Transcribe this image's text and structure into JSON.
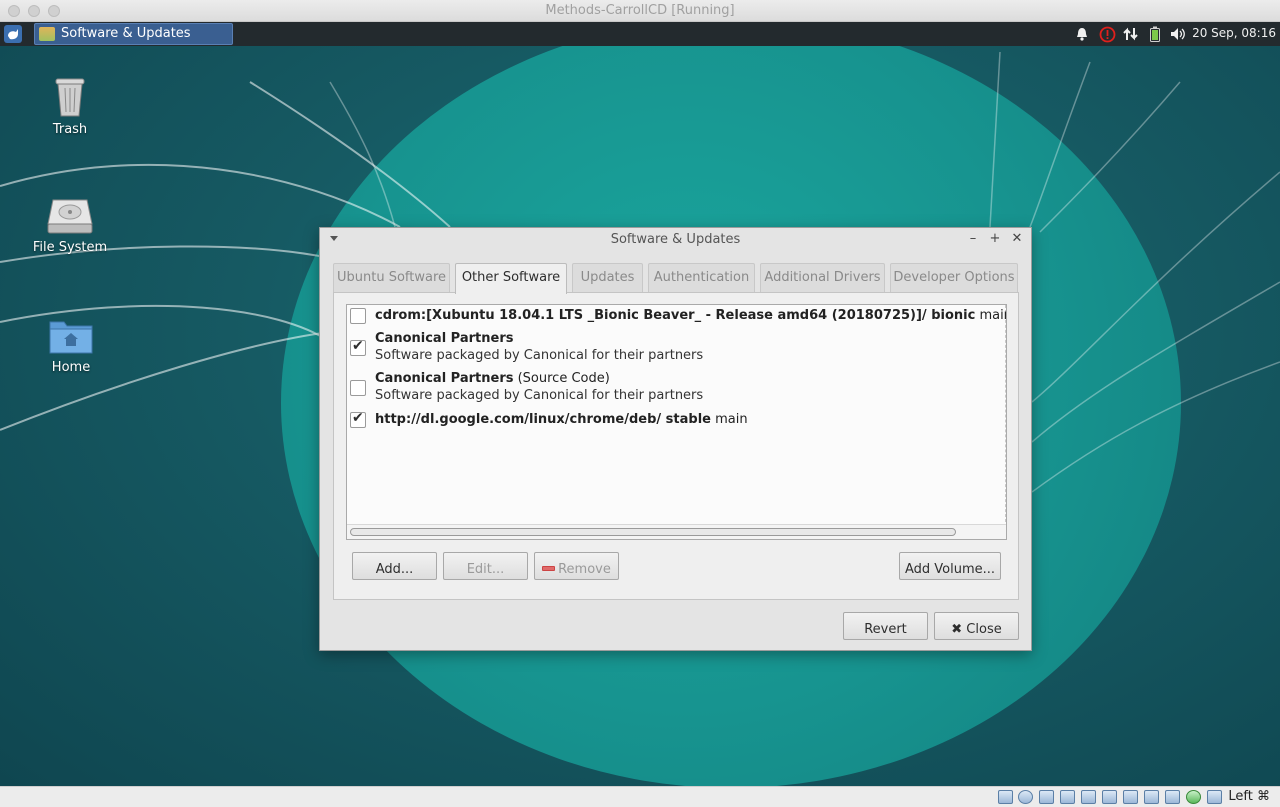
{
  "host": {
    "title": "Methods-CarrollCD [Running]",
    "host_key": "Left ⌘"
  },
  "panel": {
    "task_label": "Software & Updates",
    "clock": "20 Sep, 08:16"
  },
  "desktop_icons": [
    {
      "label": "Trash"
    },
    {
      "label": "File System"
    },
    {
      "label": "Home"
    }
  ],
  "dialog": {
    "title": "Software & Updates",
    "tabs": [
      {
        "label": "Ubuntu Software"
      },
      {
        "label": "Other Software"
      },
      {
        "label": "Updates"
      },
      {
        "label": "Authentication"
      },
      {
        "label": "Additional Drivers"
      },
      {
        "label": "Developer Options"
      }
    ],
    "active_tab": "Other Software",
    "sources": [
      {
        "checked": false,
        "bold": "cdrom:[Xubuntu 18.04.1 LTS _Bionic Beaver_ - Release amd64 (20180725)]/ bionic",
        "normal": " main multiverse restricted universe",
        "line2": ""
      },
      {
        "checked": true,
        "bold": "Canonical Partners",
        "normal": "",
        "line2": "Software packaged by Canonical for their partners"
      },
      {
        "checked": false,
        "bold": "Canonical Partners",
        "normal": " (Source Code)",
        "line2": "Software packaged by Canonical for their partners"
      },
      {
        "checked": true,
        "bold": "http://dl.google.com/linux/chrome/deb/ stable",
        "normal": " main",
        "line2": ""
      }
    ],
    "buttons": {
      "add": "Add...",
      "edit": "Edit...",
      "remove": "Remove",
      "add_volume": "Add Volume...",
      "revert": "Revert",
      "close": "Close"
    }
  },
  "colors": {
    "panel_bg": "#232a2e",
    "task_active": "#3a5f91",
    "desktop_teal": "#17938f",
    "error_red": "#e0201c"
  }
}
